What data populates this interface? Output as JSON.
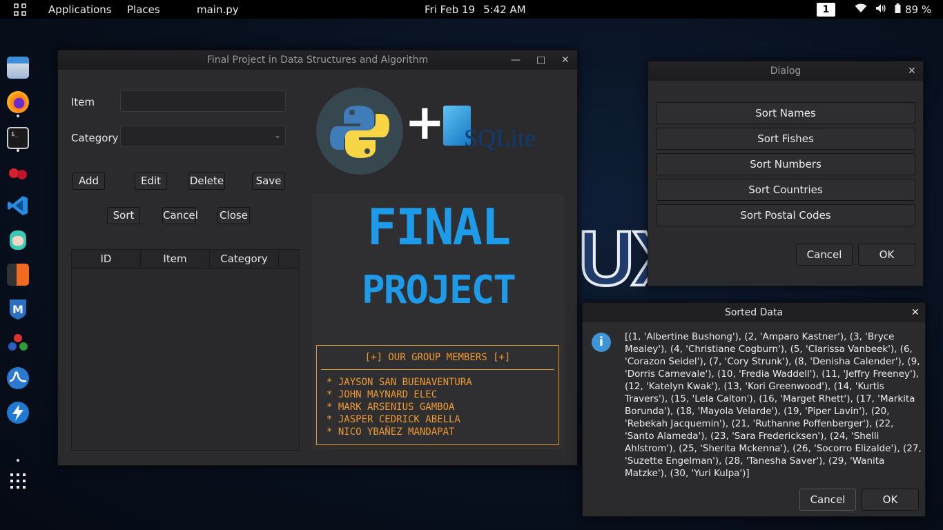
{
  "topbar": {
    "applications": "Applications",
    "places": "Places",
    "app_name": "main.py",
    "date": "Fri Feb 19",
    "time": "5:42 AM",
    "workspace": "1",
    "battery": "89 %"
  },
  "dock": {
    "icons": [
      "files-icon",
      "firefox-icon",
      "terminal-icon",
      "cherrytree-icon",
      "vscode-icon",
      "hacker-mascot-icon",
      "burpsuite-icon",
      "metasploit-icon",
      "maltego-icon",
      "wireshark-icon",
      "zaproxy-icon",
      "show-apps-icon"
    ]
  },
  "main_window": {
    "title": "Final Project in Data Structures and Algorithm",
    "item_label": "Item",
    "item_value": "",
    "category_label": "Category",
    "category_value": "",
    "buttons": {
      "add": "Add",
      "edit": "Edit",
      "delete": "Delete",
      "save": "Save",
      "sort": "Sort",
      "cancel": "Cancel",
      "close": "Close"
    },
    "table_columns": [
      "ID",
      "Item",
      "Category"
    ],
    "logo_plus": "+",
    "logo_sqlite": "SQLite",
    "banner_line1": "FINAL",
    "banner_line2": "PROJECT",
    "members_heading": "[+] OUR GROUP MEMBERS [+]",
    "members": [
      "* JAYSON SAN BUENAVENTURA",
      "* JOHN MAYNARD ELEC",
      "* MARK ARSENIUS GAMBOA",
      "* JASPER CEDRICK ABELLA",
      "* NICO YBAÑEZ MANDAPAT"
    ]
  },
  "dialog": {
    "title": "Dialog",
    "sort_buttons": [
      "Sort Names",
      "Sort Fishes",
      "Sort Numbers",
      "Sort Countries",
      "Sort Postal Codes"
    ],
    "cancel": "Cancel",
    "ok": "OK"
  },
  "sorted_dialog": {
    "title": "Sorted Data",
    "content": "[(1, 'Albertine Bushong'), (2, 'Amparo Kastner'), (3, 'Bryce Mealey'), (4, 'Christiane Cogburn'), (5, 'Clarissa Vanbeek'), (6, 'Corazon Seidel'), (7, 'Cory Strunk'), (8, 'Denisha Calender'), (9, 'Dorris Carnevale'), (10, 'Fredia Waddell'), (11, 'Jeffry Freeney'), (12, 'Katelyn Kwak'), (13, 'Kori Greenwood'), (14, 'Kurtis Travers'), (15, 'Lela Calton'), (16, 'Marget Rhett'), (17, 'Markita Borunda'), (18, 'Mayola Velarde'), (19, 'Piper Lavin'), (20, 'Rebekah Jacquemin'), (21, 'Ruthanne Poffenberger'), (22, 'Santo Alameda'), (23, 'Sara Fredericksen'), (24, 'Shelli Ahlstrom'), (25, 'Sherita Mckenna'), (26, 'Socorro Elizalde'), (27, 'Suzette Engelman'), (28, 'Tanesha Saver'), (29, 'Wanita Matzke'), (30, 'Yuri Kulpa')]",
    "cancel": "Cancel",
    "ok": "OK"
  },
  "desktop": {
    "wallpaper_text": "UX"
  },
  "colors": {
    "members_orange": "#ee9a34",
    "banner_blue": "#1e9be8",
    "info_blue": "#3d95d8"
  }
}
